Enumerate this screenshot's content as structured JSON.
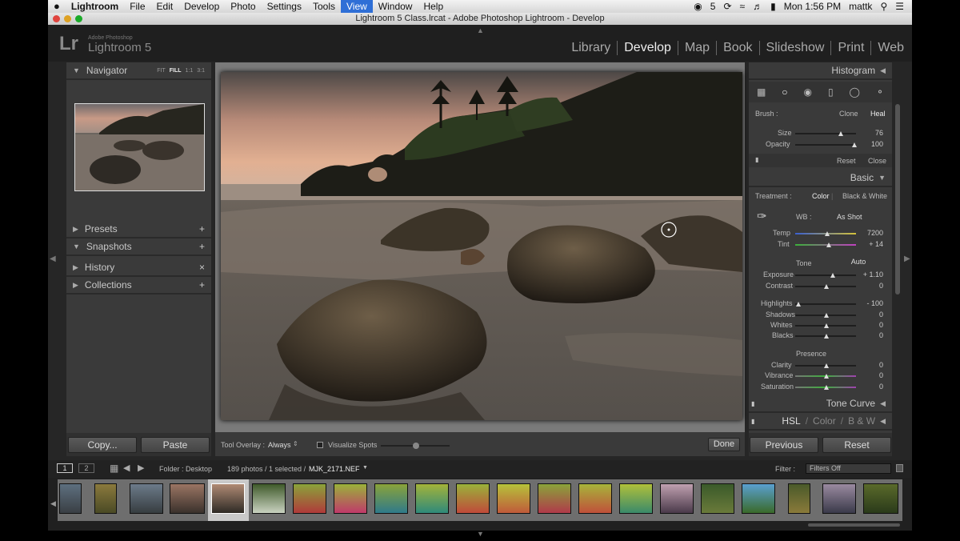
{
  "menubar": {
    "items": [
      "Lightroom",
      "File",
      "Edit",
      "Develop",
      "Photo",
      "Settings",
      "Tools",
      "View",
      "Window",
      "Help"
    ],
    "status_count": "5",
    "clock": "Mon 1:56 PM",
    "user": "mattk"
  },
  "window": {
    "title": "Lightroom 5 Class.lrcat - Adobe Photoshop Lightroom - Develop"
  },
  "brand": {
    "lr": "Lr",
    "adobe": "Adobe Photoshop",
    "name": "Lightroom 5"
  },
  "modules": [
    "Library",
    "Develop",
    "Map",
    "Book",
    "Slideshow",
    "Print",
    "Web"
  ],
  "left": {
    "navigator": {
      "title": "Navigator",
      "zooms": [
        "FIT",
        "FILL",
        "1:1",
        "3:1"
      ]
    },
    "sections": [
      {
        "label": "Presets",
        "action": "+"
      },
      {
        "label": "Snapshots",
        "action": "+"
      },
      {
        "label": "History",
        "action": "×"
      },
      {
        "label": "Collections",
        "action": "+"
      }
    ],
    "copy": "Copy...",
    "paste": "Paste"
  },
  "toolbar": {
    "overlay_label": "Tool Overlay :",
    "overlay_value": "Always",
    "visualize": "Visualize Spots",
    "done": "Done"
  },
  "right": {
    "histogram": "Histogram",
    "brush": {
      "label": "Brush :",
      "clone": "Clone",
      "heal": "Heal"
    },
    "size": {
      "label": "Size",
      "value": "76"
    },
    "opacity": {
      "label": "Opacity",
      "value": "100"
    },
    "reset": "Reset",
    "close": "Close",
    "basic": "Basic",
    "treatment": {
      "label": "Treatment :",
      "color": "Color",
      "bw": "Black & White"
    },
    "wb": {
      "label": "WB :",
      "value": "As Shot"
    },
    "temp": {
      "label": "Temp",
      "value": "7200"
    },
    "tint": {
      "label": "Tint",
      "value": "+ 14"
    },
    "tone": "Tone",
    "auto": "Auto",
    "exposure": {
      "label": "Exposure",
      "value": "+ 1.10"
    },
    "contrast": {
      "label": "Contrast",
      "value": "0"
    },
    "highlights": {
      "label": "Highlights",
      "value": "- 100"
    },
    "shadows": {
      "label": "Shadows",
      "value": "0"
    },
    "whites": {
      "label": "Whites",
      "value": "0"
    },
    "blacks": {
      "label": "Blacks",
      "value": "0"
    },
    "presence": "Presence",
    "clarity": {
      "label": "Clarity",
      "value": "0"
    },
    "vibrance": {
      "label": "Vibrance",
      "value": "0"
    },
    "saturation": {
      "label": "Saturation",
      "value": "0"
    },
    "tonecurve": "Tone Curve",
    "hsl": {
      "a": "HSL",
      "b": "Color",
      "c": "B & W",
      "sep": "/"
    },
    "previous": "Previous",
    "reset_btn": "Reset"
  },
  "filmstrip_bar": {
    "page1": "1",
    "page2": "2",
    "folder": "Folder : Desktop",
    "count": "189 photos / 1 selected /",
    "file": "MJK_2171.NEF",
    "filter_label": "Filter :",
    "filter_value": "Filters Off"
  }
}
